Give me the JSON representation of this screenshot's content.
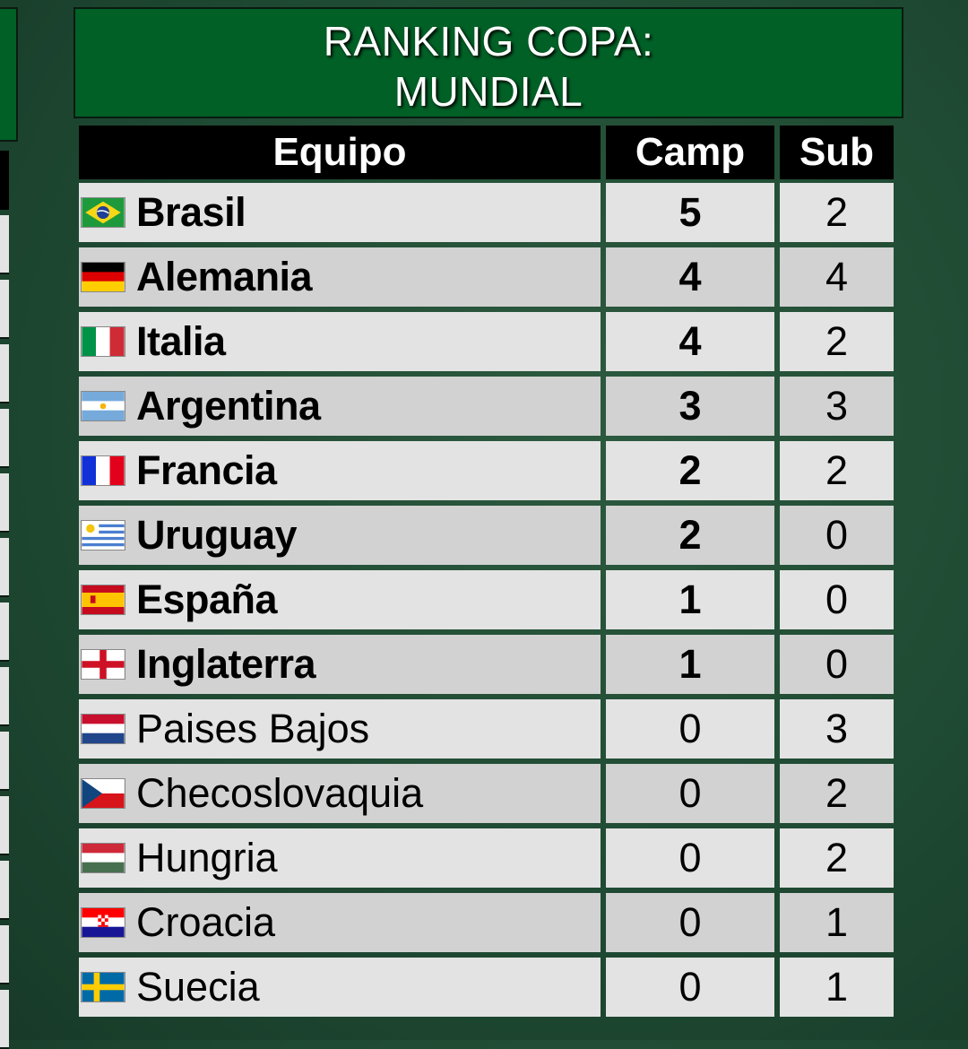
{
  "title": {
    "line1": "RANKING COPA:",
    "line2": "MUNDIAL"
  },
  "headers": {
    "team": "Equipo",
    "champ": "Camp",
    "sub": "Sub"
  },
  "rows": [
    {
      "team": "Brasil",
      "flag": "brazil-flag-icon",
      "camp": "5",
      "sub": "2"
    },
    {
      "team": "Alemania",
      "flag": "germany-flag-icon",
      "camp": "4",
      "sub": "4"
    },
    {
      "team": "Italia",
      "flag": "italy-flag-icon",
      "camp": "4",
      "sub": "2"
    },
    {
      "team": "Argentina",
      "flag": "argentina-flag-icon",
      "camp": "3",
      "sub": "3"
    },
    {
      "team": "Francia",
      "flag": "france-flag-icon",
      "camp": "2",
      "sub": "2"
    },
    {
      "team": "Uruguay",
      "flag": "uruguay-flag-icon",
      "camp": "2",
      "sub": "0"
    },
    {
      "team": "España",
      "flag": "spain-flag-icon",
      "camp": "1",
      "sub": "0"
    },
    {
      "team": "Inglaterra",
      "flag": "england-flag-icon",
      "camp": "1",
      "sub": "0"
    },
    {
      "team": "Paises Bajos",
      "flag": "netherlands-flag-icon",
      "camp": "0",
      "sub": "3"
    },
    {
      "team": "Checoslovaquia",
      "flag": "czechoslovakia-flag-icon",
      "camp": "0",
      "sub": "2"
    },
    {
      "team": "Hungria",
      "flag": "hungary-flag-icon",
      "camp": "0",
      "sub": "2"
    },
    {
      "team": "Croacia",
      "flag": "croatia-flag-icon",
      "camp": "0",
      "sub": "1"
    },
    {
      "team": "Suecia",
      "flag": "sweden-flag-icon",
      "camp": "0",
      "sub": "1"
    }
  ]
}
